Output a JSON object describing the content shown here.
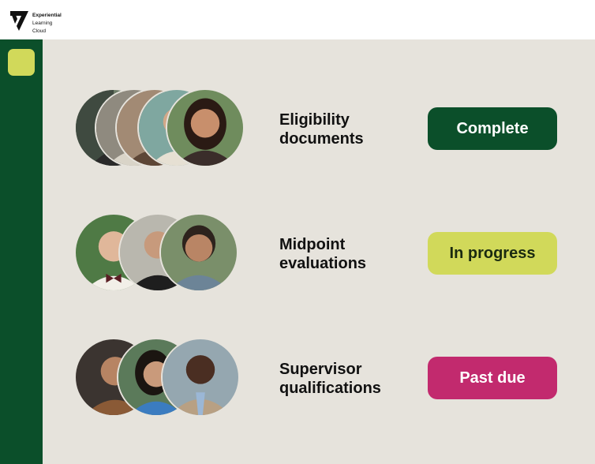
{
  "brand": {
    "line1": "Experiential",
    "line2": "Learning",
    "line3": "Cloud"
  },
  "rows": [
    {
      "label": "Eligibility\ndocuments",
      "status": "Complete",
      "status_bg": "#0b4f2a",
      "status_fg": "#ffffff"
    },
    {
      "label": "Midpoint\nevaluations",
      "status": "In progress",
      "status_bg": "#d1d95a",
      "status_fg": "#1a2a10"
    },
    {
      "label": "Supervisor\nqualifications",
      "status": "Past due",
      "status_bg": "#c22a6e",
      "status_fg": "#ffffff"
    }
  ],
  "colors": {
    "sidebar": "#0b4f2a",
    "accent_lime": "#d1d95a",
    "background": "#e6e3dc"
  }
}
